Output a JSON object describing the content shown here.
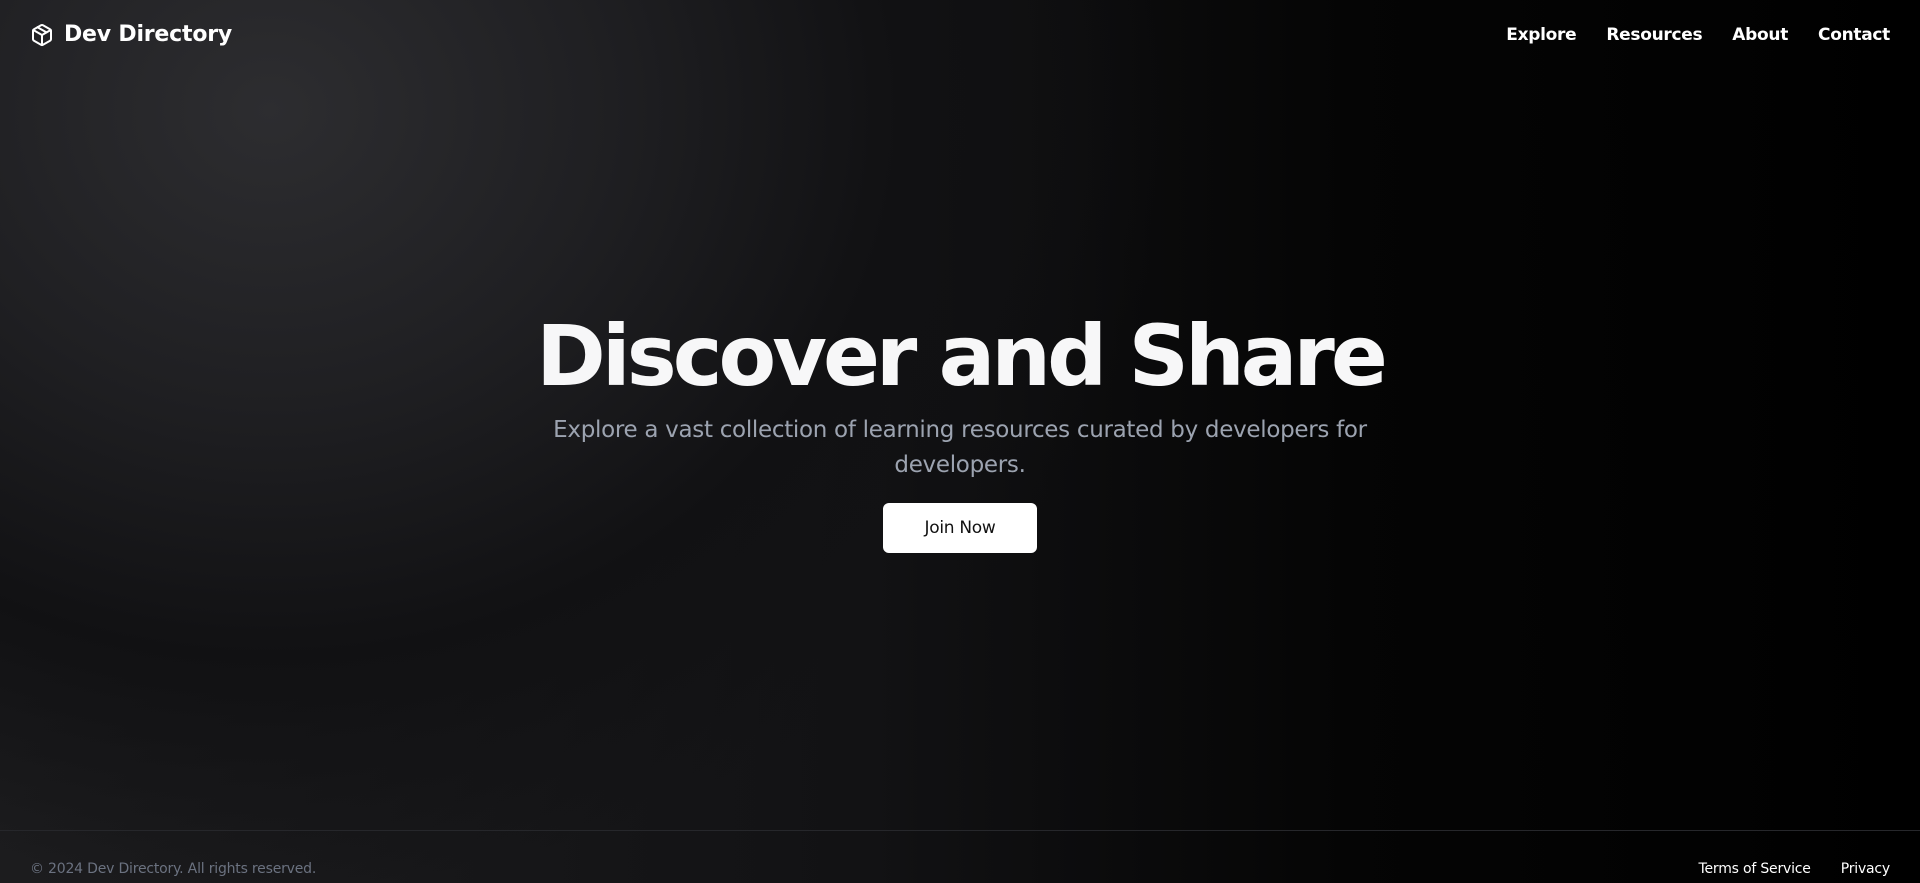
{
  "header": {
    "brand": {
      "name": "Dev Directory",
      "icon": "package-box-icon"
    },
    "nav": [
      {
        "label": "Explore"
      },
      {
        "label": "Resources"
      },
      {
        "label": "About"
      },
      {
        "label": "Contact"
      }
    ]
  },
  "hero": {
    "title": "Discover and Share",
    "subtitle": "Explore a vast collection of learning resources curated by developers for developers.",
    "cta_label": "Join Now"
  },
  "footer": {
    "copyright": "© 2024 Dev Directory. All rights reserved.",
    "links": [
      {
        "label": "Terms of Service"
      },
      {
        "label": "Privacy"
      }
    ]
  },
  "colors": {
    "background_dark": "#000000",
    "background_light": "#2d2d30",
    "text_primary": "#ffffff",
    "text_muted": "#9ca3b0",
    "footer_text": "#6b7280",
    "button_bg": "#ffffff",
    "button_text": "#111111"
  }
}
